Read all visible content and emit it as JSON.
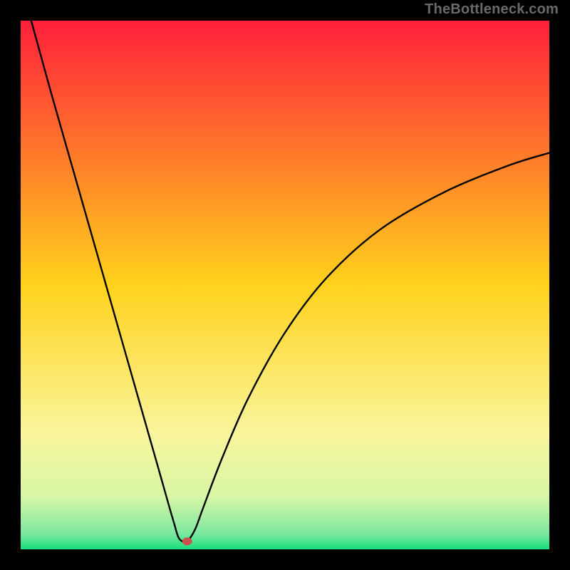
{
  "watermark": "TheBottleneck.com",
  "chart_data": {
    "type": "line",
    "title": "",
    "xlabel": "",
    "ylabel": "",
    "xlim": [
      0,
      100
    ],
    "ylim": [
      0,
      100
    ],
    "grid": false,
    "legend": false,
    "background_gradient": {
      "stops": [
        {
          "pos": 0.0,
          "color": "#ff1f3a"
        },
        {
          "pos": 0.5,
          "color": "#ffd21c"
        },
        {
          "pos": 0.78,
          "color": "#f9f59c"
        },
        {
          "pos": 0.9,
          "color": "#d8f6a6"
        },
        {
          "pos": 0.97,
          "color": "#7de8a0"
        },
        {
          "pos": 1.0,
          "color": "#16e07e"
        }
      ]
    },
    "marker": {
      "x": 31.5,
      "y": 1.5,
      "color": "#c9524c"
    },
    "series": [
      {
        "name": "curve",
        "color": "#000000",
        "x": [
          2.0,
          6.0,
          10.0,
          14.0,
          18.0,
          22.0,
          26.0,
          27.5,
          29.0,
          30.0,
          31.5,
          33.0,
          34.5,
          38.0,
          43.0,
          50.0,
          58.0,
          68.0,
          80.0,
          92.0,
          100.0
        ],
        "y": [
          100.0,
          85.5,
          71.5,
          57.5,
          43.5,
          29.5,
          15.5,
          10.2,
          5.0,
          2.0,
          1.6,
          3.8,
          7.8,
          17.0,
          28.5,
          41.0,
          51.5,
          60.5,
          67.5,
          72.5,
          75.0
        ]
      }
    ]
  }
}
